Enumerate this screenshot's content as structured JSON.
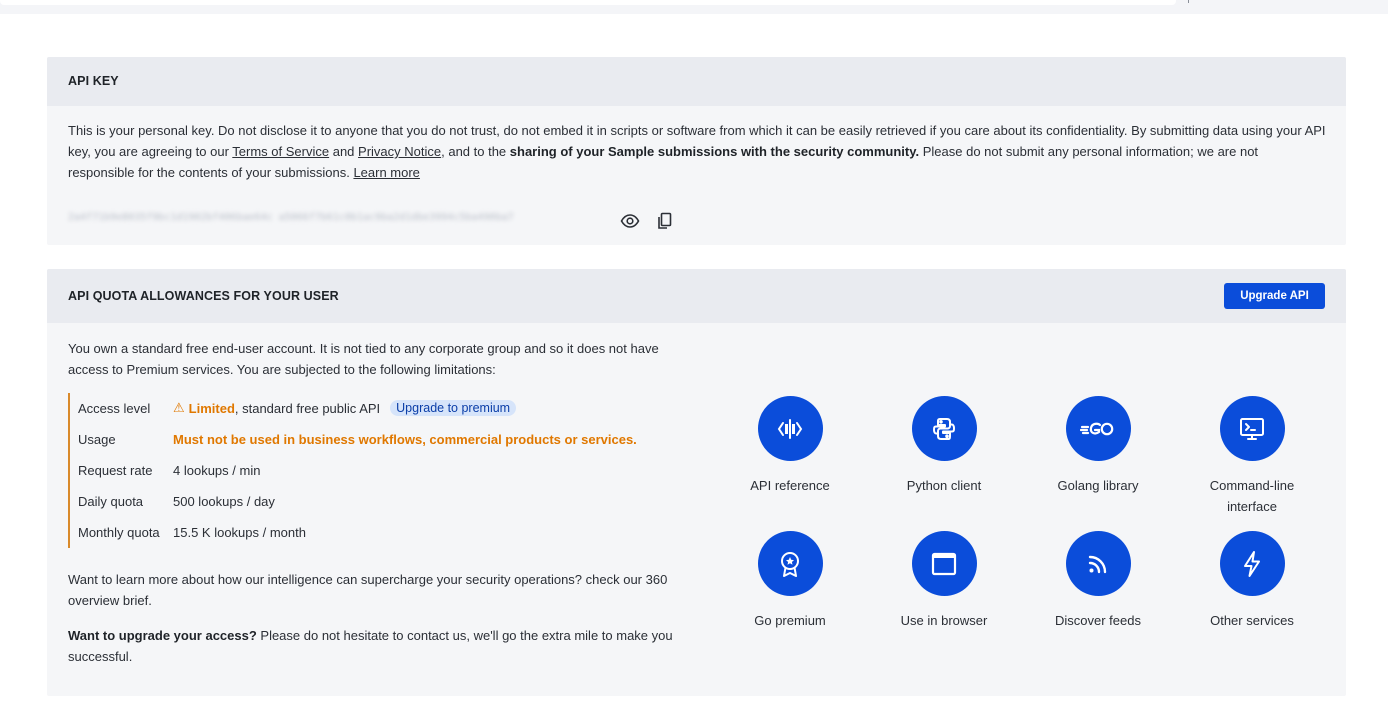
{
  "api_key": {
    "title": "API KEY",
    "desc_part1": "This is your personal key. Do not disclose it to anyone that you do not trust, do not embed it in scripts or software from which it can be easily retrieved if you care about its confidentiality. By submitting data using your API key, you are agreeing to our ",
    "terms_link": "Terms of Service",
    "and_text": " and ",
    "privacy_link": "Privacy Notice",
    "desc_part2": ", and to the ",
    "desc_bold": "sharing of your Sample submissions with the security community.",
    "desc_part3": " Please do not submit any personal information; we are not responsible for the contents of your submissions. ",
    "learn_more": "Learn more",
    "masked_key": "2a4f71b9e8035f9bc1d1902bf406bae64c a5066f7b61c0b1ac9ba2d1dbe3994c5ba490ba7",
    "icons": {
      "show": "eye-icon",
      "copy": "copy-icon"
    }
  },
  "quota": {
    "title": "API QUOTA ALLOWANCES FOR YOUR USER",
    "upgrade_button": "Upgrade API",
    "intro": "You own a standard free end-user account. It is not tied to any corporate group and so it does not have access to Premium services. You are subjected to the following limitations:",
    "limits": {
      "access_level": {
        "label": "Access level",
        "warn_icon": "⚠",
        "limited": "Limited",
        "rest": ", standard free public API",
        "pill": "Upgrade to premium"
      },
      "usage": {
        "label": "Usage",
        "value": "Must not be used in business workflows, commercial products or services."
      },
      "request_rate": {
        "label": "Request rate",
        "value": "4 lookups / min"
      },
      "daily_quota": {
        "label": "Daily quota",
        "value": "500 lookups / day"
      },
      "monthly_quota": {
        "label": "Monthly quota",
        "value": "15.5 K lookups / month"
      }
    },
    "learn_text": "Want to learn more about how our intelligence can supercharge your security operations? check our 360 overview brief.",
    "upgrade_bold": "Want to upgrade your access?",
    "upgrade_rest": " Please do not hesitate to contact us, we'll go the extra mile to make you successful.",
    "tiles": [
      {
        "label": "API reference",
        "icon": "api-reference-icon"
      },
      {
        "label": "Python client",
        "icon": "python-icon"
      },
      {
        "label": "Golang library",
        "icon": "golang-icon"
      },
      {
        "label": "Command-line interface",
        "icon": "terminal-icon"
      },
      {
        "label": "Go premium",
        "icon": "award-icon"
      },
      {
        "label": "Use in browser",
        "icon": "browser-window-icon"
      },
      {
        "label": "Discover feeds",
        "icon": "rss-feed-icon"
      },
      {
        "label": "Other services",
        "icon": "lightning-icon"
      }
    ]
  },
  "colors": {
    "accent": "#0b4dda",
    "warning": "#e07800",
    "card_bg": "#f5f6f8",
    "card_head_bg": "#e9ebf0"
  }
}
